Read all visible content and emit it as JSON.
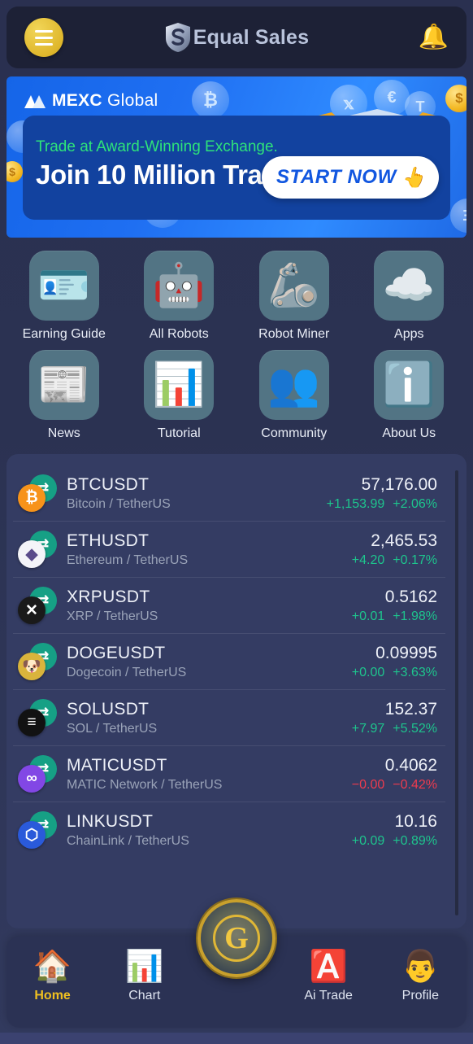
{
  "header": {
    "menu_icon": "hamburger-menu-icon",
    "logo_icon": "shield-s-logo-icon",
    "title": "Equal Sales",
    "bell_icon": "bell-notification-icon"
  },
  "banner": {
    "brand_mark": "mexc-triangle-logo",
    "brand_name_bold": "MEXC",
    "brand_name_light": " Global",
    "tagline": "Trade at Award-Winning Exchange.",
    "headline": "Join 10 Million Traders",
    "cta_label": "START NOW",
    "cta_cursor_icon": "pointing-hand-cursor-icon",
    "tagline_color": "#2ee37a",
    "background_color": "#1f6ff2"
  },
  "menu_grid": [
    {
      "label": "Earning Guide",
      "icon": "signpost-icon",
      "glyph": "🪪"
    },
    {
      "label": "All Robots",
      "icon": "robot-face-icon",
      "glyph": "🤖"
    },
    {
      "label": "Robot Miner",
      "icon": "mechanical-arm-icon",
      "glyph": "🦾"
    },
    {
      "label": "Apps",
      "icon": "cloud-download-icon",
      "glyph": "☁️"
    },
    {
      "label": "News",
      "icon": "newspaper-icon",
      "glyph": "📰"
    },
    {
      "label": "Tutorial",
      "icon": "presentation-board-icon",
      "glyph": "📊"
    },
    {
      "label": "Community",
      "icon": "people-group-icon",
      "glyph": "👥"
    },
    {
      "label": "About Us",
      "icon": "info-bubble-icon",
      "glyph": "ℹ️"
    }
  ],
  "tickers": [
    {
      "symbol": "BTCUSDT",
      "name": "Bitcoin / TetherUS",
      "price": "57,176.00",
      "change": "+1,153.99",
      "percent": "+2.06%",
      "direction": "up",
      "base_icon": "bitcoin-icon",
      "base_glyph": "₿",
      "base_color": "#f7931a"
    },
    {
      "symbol": "ETHUSDT",
      "name": "Ethereum / TetherUS",
      "price": "2,465.53",
      "change": "+4.20",
      "percent": "+0.17%",
      "direction": "up",
      "base_icon": "ethereum-icon",
      "base_glyph": "◆",
      "base_color": "#f4f4f8"
    },
    {
      "symbol": "XRPUSDT",
      "name": "XRP / TetherUS",
      "price": "0.5162",
      "change": "+0.01",
      "percent": "+1.98%",
      "direction": "up",
      "base_icon": "xrp-icon",
      "base_glyph": "✕",
      "base_color": "#1a1a1a"
    },
    {
      "symbol": "DOGEUSDT",
      "name": "Dogecoin / TetherUS",
      "price": "0.09995",
      "change": "+0.00",
      "percent": "+3.63%",
      "direction": "up",
      "base_icon": "dogecoin-icon",
      "base_glyph": "🐶",
      "base_color": "#d9b43c"
    },
    {
      "symbol": "SOLUSDT",
      "name": "SOL / TetherUS",
      "price": "152.37",
      "change": "+7.97",
      "percent": "+5.52%",
      "direction": "up",
      "base_icon": "solana-icon",
      "base_glyph": "≡",
      "base_color": "#121212"
    },
    {
      "symbol": "MATICUSDT",
      "name": "MATIC Network / TetherUS",
      "price": "0.4062",
      "change": "−0.00",
      "percent": "−0.42%",
      "direction": "down",
      "base_icon": "polygon-matic-icon",
      "base_glyph": "∞",
      "base_color": "#8247e5"
    },
    {
      "symbol": "LINKUSDT",
      "name": "ChainLink / TetherUS",
      "price": "10.16",
      "change": "+0.09",
      "percent": "+0.89%",
      "direction": "up",
      "base_icon": "chainlink-icon",
      "base_glyph": "⬡",
      "base_color": "#2a5ada"
    }
  ],
  "quote_icon_label": "USDT",
  "bottom_nav": {
    "items": [
      {
        "label": "Home",
        "icon": "home-icon",
        "glyph": "🏠",
        "active": true
      },
      {
        "label": "Chart",
        "icon": "bar-chart-icon",
        "glyph": "📊",
        "active": false
      },
      {
        "label": "Ai Trade",
        "icon": "ai-trade-icon",
        "glyph": "🅰️",
        "active": false
      },
      {
        "label": "Profile",
        "icon": "profile-person-icon",
        "glyph": "👨",
        "active": false
      }
    ],
    "center_button": {
      "icon": "gold-coin-g-icon",
      "letter": "G"
    },
    "active_color": "#f0c020"
  },
  "colors": {
    "page_background": "#2b3252",
    "card_background": "#343c63",
    "header_background": "#1d2136",
    "tile_background": "#527484",
    "up_green": "#1ec48d",
    "down_red": "#ef3b4e",
    "accent_gold": "#e8c33a"
  }
}
